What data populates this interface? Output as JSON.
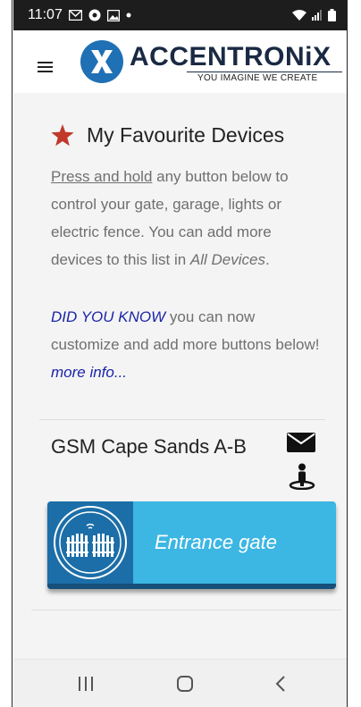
{
  "status_bar": {
    "time": "11:07",
    "icons": [
      "gmail-icon",
      "chrome-icon",
      "image-icon",
      "dot-icon"
    ],
    "right_icons": [
      "wifi-icon",
      "signal-icon",
      "battery-icon"
    ]
  },
  "header": {
    "brand": "ACCENTRONiX",
    "tagline": "YOU IMAGINE WE CREATE"
  },
  "favourites": {
    "title": "My Favourite Devices",
    "intro_link": "Press and hold",
    "intro_rest": " any button below to control your gate, garage, lights or electric fence. You can add more devices to this list in ",
    "intro_emph": "All Devices",
    "intro_end": ".",
    "dyk_lead": "DID YOU KNOW",
    "dyk_rest": " you can now customize and add more buttons below! ",
    "dyk_link": "more info..."
  },
  "device_group": {
    "name": "GSM Cape Sands A-B",
    "buttons": [
      {
        "label": "Entrance gate",
        "icon": "gate-icon"
      }
    ]
  },
  "colors": {
    "button_bg": "#3cb6e3",
    "icon_box": "#1c6ea8",
    "link_blue": "#1b24a8",
    "star_red": "#c0392b"
  }
}
